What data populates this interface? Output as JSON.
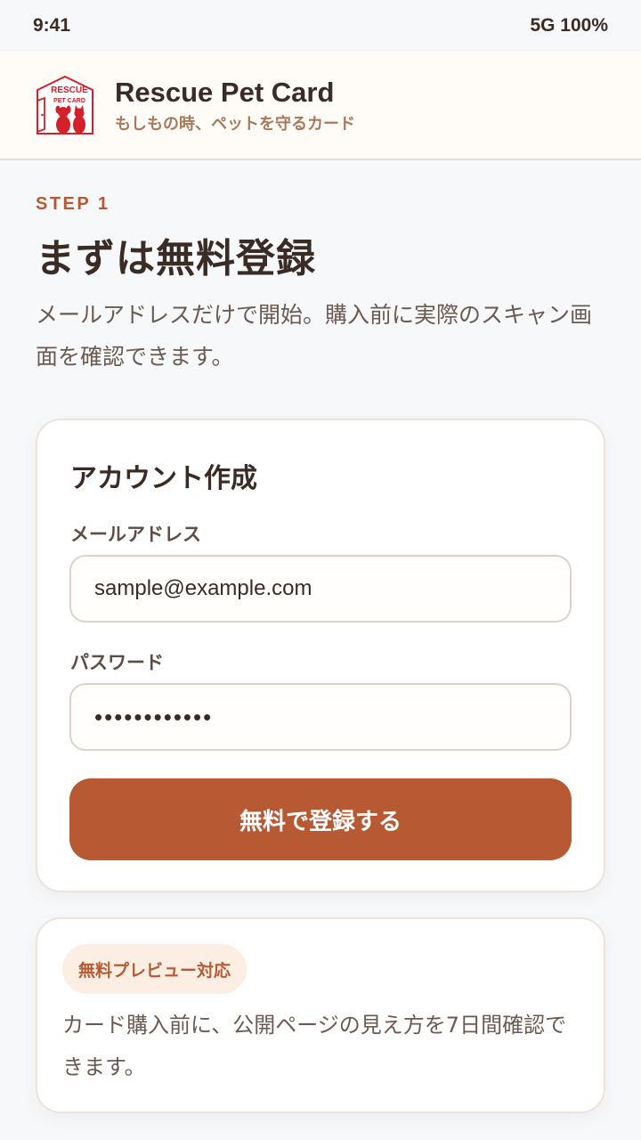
{
  "status_bar": {
    "time": "9:41",
    "network": "5G 100%"
  },
  "header": {
    "logo": {
      "text_top": "RESCUE",
      "text_bottom": "PET CARD",
      "color": "#d4202a"
    },
    "title": "Rescue Pet Card",
    "subtitle": "もしもの時、ペットを守るカード"
  },
  "intro": {
    "step": "STEP 1",
    "title": "まずは無料登録",
    "description": "メールアドレスだけで開始。購入前に実際のスキャン画面を確認できます。"
  },
  "form": {
    "title": "アカウント作成",
    "email_label": "メールアドレス",
    "email_value": "sample@example.com",
    "password_label": "パスワード",
    "password_value": "••••••••••••",
    "submit_label": "無料で登録する"
  },
  "info": {
    "badge": "無料プレビュー対応",
    "text": "カード購入前に、公開ページの見え方を7日間確認できます。"
  },
  "colors": {
    "accent": "#b75a34",
    "background": "#f6f8fa",
    "header_bg": "#fffcf8",
    "badge_bg": "#fdeee4",
    "text_primary": "#3a2b24",
    "text_secondary": "#6b5a51"
  }
}
